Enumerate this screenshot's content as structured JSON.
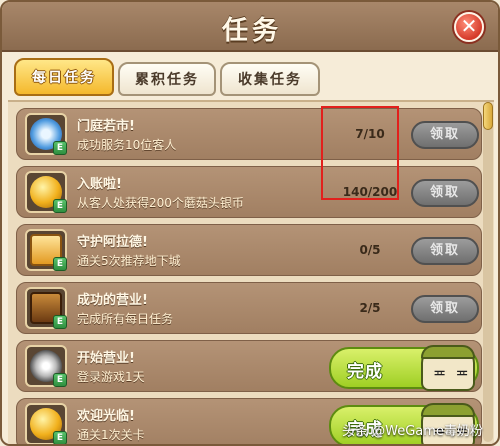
{
  "window": {
    "title": "任务",
    "close_label": "✕"
  },
  "tabs": [
    {
      "label": "每日任务",
      "active": true
    },
    {
      "label": "累积任务",
      "active": false
    },
    {
      "label": "收集任务",
      "active": false
    }
  ],
  "tasks": [
    {
      "name": "门庭若市!",
      "desc": "成功服务10位客人",
      "progress": "7/10",
      "action": "领取",
      "status": "in-progress",
      "icon": "lightning-icon"
    },
    {
      "name": "入账啦!",
      "desc": "从客人处获得200个蘑菇头银币",
      "progress": "140/200",
      "action": "领取",
      "status": "in-progress",
      "icon": "coin-icon"
    },
    {
      "name": "守护阿拉德!",
      "desc": "通关5次推荐地下城",
      "progress": "0/5",
      "action": "领取",
      "status": "in-progress",
      "icon": "treasure-box-icon"
    },
    {
      "name": "成功的营业!",
      "desc": "完成所有每日任务",
      "progress": "2/5",
      "action": "领取",
      "status": "in-progress",
      "icon": "chest-icon"
    },
    {
      "name": "开始营业!",
      "desc": "登录游戏1天",
      "progress": "",
      "action": "完成",
      "status": "done",
      "icon": "gear-coin-icon"
    },
    {
      "name": "欢迎光临!",
      "desc": "通关1次关卡",
      "progress": "",
      "action": "完成",
      "status": "done",
      "icon": "coin-icon"
    }
  ],
  "icon_tag": "E",
  "mascot_face": "≖ ≖",
  "watermark": "头条 @WeGame毒奶粉",
  "colors": {
    "accent": "#f4b82c",
    "done": "#9fcf24",
    "disabled": "#6f6f6f",
    "highlight": "#e2201c"
  }
}
